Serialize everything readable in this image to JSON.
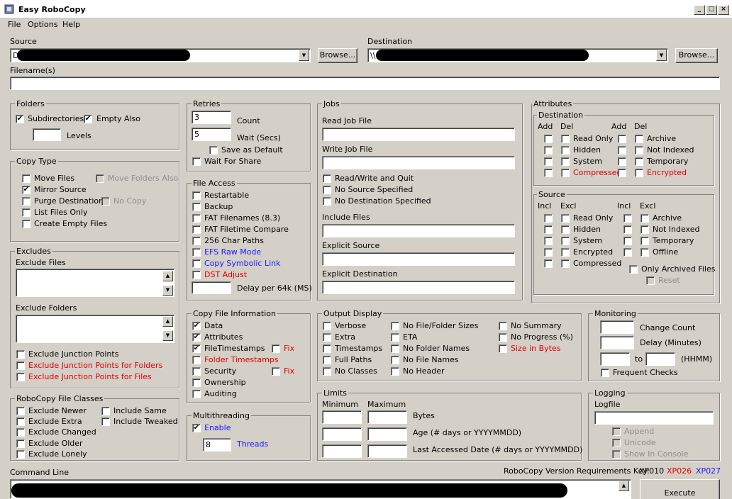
{
  "window": {
    "title": "Easy RoboCopy",
    "min": "_",
    "max": "□",
    "close": "×"
  },
  "menu": {
    "file": "File",
    "options": "Options",
    "help": "Help"
  },
  "source": {
    "label": "Source",
    "value": "D",
    "browse": "Browse..."
  },
  "destination": {
    "label": "Destination",
    "value": "\\\\",
    "browse": "Browse..."
  },
  "filenames": {
    "label": "Filename(s)"
  },
  "folders": {
    "title": "Folders",
    "subdirectories": "Subdirectories",
    "empty_also": "Empty Also",
    "levels": "Levels"
  },
  "copy_type": {
    "title": "Copy Type",
    "move_files": "Move Files",
    "move_folders_also": "Move Folders Also",
    "mirror_source": "Mirror Source",
    "purge_destination": "Purge Destination",
    "no_copy": "No Copy",
    "list_files_only": "List Files Only",
    "create_empty_files": "Create Empty Files"
  },
  "excludes": {
    "title": "Excludes",
    "exclude_files": "Exclude Files",
    "exclude_folders": "Exclude Folders",
    "junction_points": "Exclude Junction Points",
    "junction_points_folders": "Exclude Junction Points for Folders",
    "junction_points_files": "Exclude Junction Points for Files"
  },
  "classes": {
    "title": "RoboCopy File Classes",
    "newer": "Exclude Newer",
    "same": "Include Same",
    "extra": "Exclude Extra",
    "tweaked": "Include Tweaked",
    "changed": "Exclude Changed",
    "older": "Exclude Older",
    "lonely": "Exclude Lonely"
  },
  "retries": {
    "title": "Retries",
    "count_value": "3",
    "count": "Count",
    "wait_value": "5",
    "wait": "Wait (Secs)",
    "save_default": "Save as Default",
    "wait_for_share": "Wait For Share"
  },
  "file_access": {
    "title": "File Access",
    "restartable": "Restartable",
    "backup": "Backup",
    "fat_filenames": "FAT Filenames (8.3)",
    "fat_filetime": "FAT Filetime Compare",
    "char_paths": "256 Char Paths",
    "efs_raw": "EFS Raw Mode",
    "copy_symlink": "Copy Symbolic Link",
    "dst_adjust": "DST Adjust",
    "delay": "Delay per 64k (MS)"
  },
  "copy_info": {
    "title": "Copy File Information",
    "data": "Data",
    "attributes": "Attributes",
    "timestamps": "FileTimestamps",
    "fix": "Fix",
    "folder_timestamps": "Folder Timestamps",
    "security": "Security",
    "ownership": "Ownership",
    "auditing": "Auditing"
  },
  "multithreading": {
    "title": "Multithreading",
    "enable": "Enable",
    "threads_value": "8",
    "threads": "Threads"
  },
  "jobs": {
    "title": "Jobs",
    "read_job": "Read Job File",
    "write_job": "Write Job File",
    "rw_quit": "Read/Write and Quit",
    "no_source": "No Source Specified",
    "no_dest": "No Destination Specified",
    "include_files": "Include Files",
    "explicit_source": "Explicit Source",
    "explicit_dest": "Explicit Destination"
  },
  "output": {
    "title": "Output Display",
    "verbose": "Verbose",
    "extra": "Extra",
    "timestamps": "Timestamps",
    "full_paths": "Full Paths",
    "no_classes": "No Classes",
    "no_sizes": "No File/Folder Sizes",
    "eta": "ETA",
    "no_folder_names": "No Folder Names",
    "no_file_names": "No File Names",
    "no_header": "No Header",
    "no_summary": "No Summary",
    "no_progress": "No Progress (%)",
    "size_bytes": "Size in Bytes"
  },
  "limits": {
    "title": "Limits",
    "minimum": "Minimum",
    "maximum": "Maximum",
    "bytes": "Bytes",
    "age": "Age (# days or YYYYMMDD)",
    "last_accessed": "Last Accessed Date (# days or YYYYMMDD)"
  },
  "attributes": {
    "title": "Attributes",
    "dest": "Destination",
    "source": "Source",
    "add": "Add",
    "del": "Del",
    "incl": "Incl",
    "excl": "Excl",
    "read_only": "Read Only",
    "hidden": "Hidden",
    "system": "System",
    "compressed": "Compressed",
    "archive": "Archive",
    "not_indexed": "Not Indexed",
    "temporary": "Temporary",
    "encrypted": "Encrypted",
    "offline": "Offline",
    "only_archived": "Only Archived Files",
    "reset": "Reset"
  },
  "monitoring": {
    "title": "Monitoring",
    "change_count": "Change Count",
    "delay_minutes": "Delay (Minutes)",
    "to": "to",
    "hhmm": "(HHMM)",
    "frequent_checks": "Frequent Checks"
  },
  "logging": {
    "title": "Logging",
    "logfile": "Logfile",
    "append": "Append",
    "unicode": "Unicode",
    "show_console": "Show In Console"
  },
  "command": {
    "label": "Command Line",
    "version_key": "RoboCopy Version Requirements Key:",
    "xp010": "XP010",
    "xp026": "XP026",
    "xp027": "XP027",
    "execute": "Execute"
  },
  "colors": {
    "red": "#e00000",
    "blue": "#1a1aff",
    "face": "#d4d0c8"
  }
}
